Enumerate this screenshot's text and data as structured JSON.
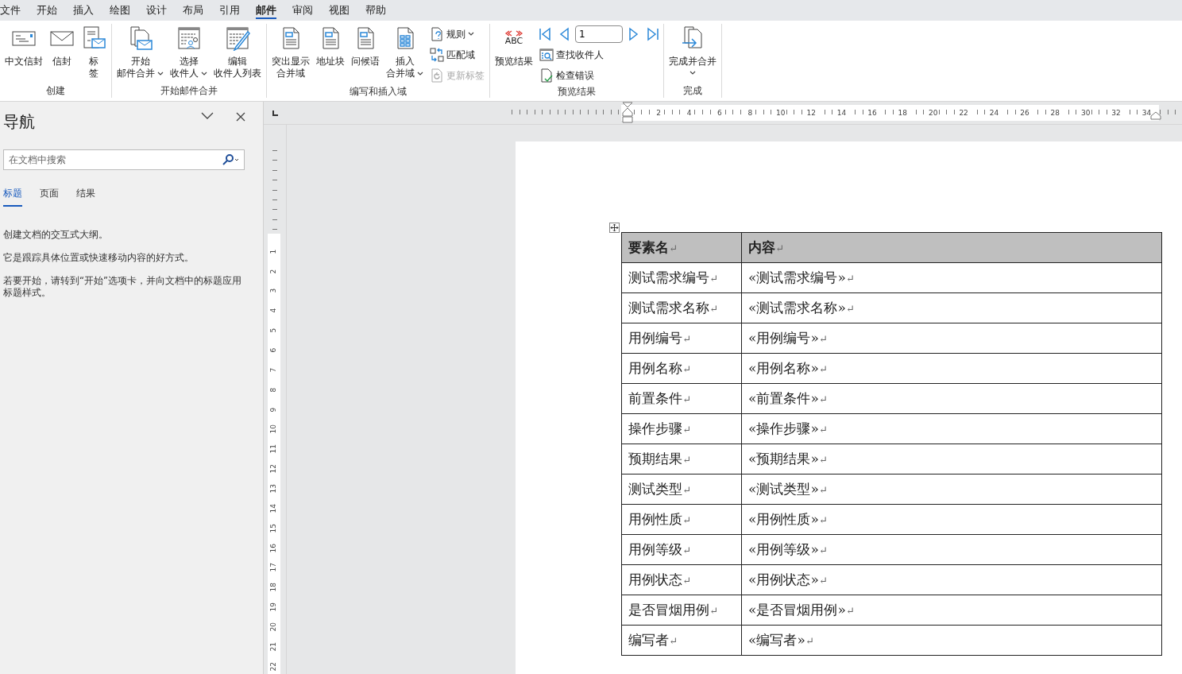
{
  "menu_tabs": [
    {
      "label": "文件",
      "selected": false
    },
    {
      "label": "开始",
      "selected": false
    },
    {
      "label": "插入",
      "selected": false
    },
    {
      "label": "绘图",
      "selected": false
    },
    {
      "label": "设计",
      "selected": false
    },
    {
      "label": "布局",
      "selected": false
    },
    {
      "label": "引用",
      "selected": false
    },
    {
      "label": "邮件",
      "selected": true
    },
    {
      "label": "审阅",
      "selected": false
    },
    {
      "label": "视图",
      "selected": false
    },
    {
      "label": "帮助",
      "selected": false
    }
  ],
  "ribbon_groups": [
    {
      "label": "创建",
      "columns": [
        {
          "kind": "large",
          "lines": [
            "中文信封"
          ],
          "dropdown": false,
          "disabled": false
        },
        {
          "kind": "large",
          "lines": [
            "信封"
          ],
          "dropdown": false,
          "disabled": false
        },
        {
          "kind": "large",
          "lines": [
            "标",
            "签"
          ],
          "dropdown": false,
          "disabled": false
        }
      ]
    },
    {
      "label": "开始邮件合并",
      "columns": [
        {
          "kind": "large",
          "lines": [
            "开始",
            "邮件合并"
          ],
          "dropdown": true,
          "disabled": false
        },
        {
          "kind": "large",
          "lines": [
            "选择",
            "收件人"
          ],
          "dropdown": true,
          "disabled": false
        },
        {
          "kind": "large",
          "lines": [
            "编辑",
            "收件人列表"
          ],
          "dropdown": false,
          "disabled": false
        }
      ]
    },
    {
      "label": "编写和插入域",
      "columns": [
        {
          "kind": "large",
          "lines": [
            "突出显示",
            "合并域"
          ],
          "dropdown": false,
          "disabled": false
        },
        {
          "kind": "large",
          "lines": [
            "地址块"
          ],
          "dropdown": false,
          "disabled": false
        },
        {
          "kind": "large",
          "lines": [
            "问候语"
          ],
          "dropdown": false,
          "disabled": false
        },
        {
          "kind": "large",
          "lines": [
            "插入",
            "合并域"
          ],
          "dropdown": true,
          "disabled": false
        },
        {
          "kind": "stack",
          "items": [
            {
              "kind": "small",
              "label": "规则",
              "dropdown": true,
              "disabled": false
            },
            {
              "kind": "small",
              "label": "匹配域",
              "dropdown": false,
              "disabled": false
            },
            {
              "kind": "small",
              "label": "更新标签",
              "dropdown": false,
              "disabled": true
            }
          ]
        }
      ]
    },
    {
      "label": "预览结果",
      "columns": [
        {
          "kind": "large",
          "lines": [
            "预览结果"
          ],
          "icon_caption": "ABC",
          "dropdown": false,
          "disabled": false
        },
        {
          "kind": "stack",
          "items": [
            {
              "kind": "nav",
              "value": "1"
            },
            {
              "kind": "small",
              "label": "查找收件人",
              "dropdown": false,
              "disabled": false
            },
            {
              "kind": "small",
              "label": "检查错误",
              "dropdown": false,
              "disabled": false
            }
          ]
        }
      ]
    },
    {
      "label": "完成",
      "columns": [
        {
          "kind": "large",
          "lines": [
            "完成并合并"
          ],
          "dropdown": true,
          "disabled": false
        }
      ]
    }
  ],
  "navigation": {
    "title": "导航",
    "search": {
      "placeholder": "在文档中搜索"
    },
    "tabs": [
      {
        "label": "标题",
        "selected": true
      },
      {
        "label": "页面",
        "selected": false
      },
      {
        "label": "结果",
        "selected": false
      }
    ],
    "paragraphs": [
      "创建文档的交互式大纲。",
      "它是跟踪具体位置或快速移动内容的好方式。",
      "若要开始，请转到“开始”选项卡，并向文档中的标题应用标题样式。"
    ]
  },
  "horizontal_ruler": [
    "2",
    "4",
    "6",
    "8",
    "10",
    "12",
    "14",
    "16",
    "18",
    "20",
    "22",
    "24",
    "26",
    "28",
    "30",
    "32",
    "34"
  ],
  "vertical_ruler": [
    "1",
    "2",
    "3",
    "4",
    "5",
    "6",
    "7",
    "8",
    "9",
    "10",
    "11",
    "12",
    "13",
    "14",
    "15",
    "16",
    "17",
    "18",
    "19",
    "20",
    "21",
    "22"
  ],
  "table": {
    "header": [
      {
        "text": "要素名",
        "mark": "↵"
      },
      {
        "text": "内容",
        "mark": "↵"
      }
    ],
    "rows": [
      [
        {
          "text": "测试需求编号",
          "mark": "↵"
        },
        {
          "text": "«测试需求编号»",
          "mark": "↵"
        }
      ],
      [
        {
          "text": "测试需求名称",
          "mark": "↵"
        },
        {
          "text": "«测试需求名称»",
          "mark": "↵"
        }
      ],
      [
        {
          "text": "用例编号",
          "mark": "↵"
        },
        {
          "text": "«用例编号»",
          "mark": "↵"
        }
      ],
      [
        {
          "text": "用例名称",
          "mark": "↵"
        },
        {
          "text": "«用例名称»",
          "mark": "↵"
        }
      ],
      [
        {
          "text": "前置条件",
          "mark": "↵"
        },
        {
          "text": "«前置条件»",
          "mark": "↵"
        }
      ],
      [
        {
          "text": "操作步骤",
          "mark": "↵"
        },
        {
          "text": "«操作步骤»",
          "mark": "↵"
        }
      ],
      [
        {
          "text": "预期结果",
          "mark": "↵"
        },
        {
          "text": "«预期结果»",
          "mark": "↵"
        }
      ],
      [
        {
          "text": "测试类型",
          "mark": "↵"
        },
        {
          "text": "«测试类型»",
          "mark": "↵"
        }
      ],
      [
        {
          "text": "用例性质",
          "mark": "↵"
        },
        {
          "text": "«用例性质»",
          "mark": "↵"
        }
      ],
      [
        {
          "text": "用例等级",
          "mark": "↵"
        },
        {
          "text": "«用例等级»",
          "mark": "↵"
        }
      ],
      [
        {
          "text": "用例状态",
          "mark": "↵"
        },
        {
          "text": "«用例状态»",
          "mark": "↵"
        }
      ],
      [
        {
          "text": "是否冒烟用例",
          "mark": "↵"
        },
        {
          "text": "«是否冒烟用例»",
          "mark": "↵"
        }
      ],
      [
        {
          "text": "编写者",
          "mark": "↵"
        },
        {
          "text": "«编写者»",
          "mark": "↵"
        }
      ]
    ]
  }
}
